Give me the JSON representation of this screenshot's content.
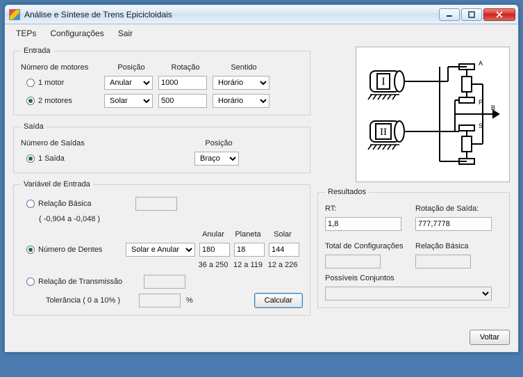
{
  "window": {
    "title": "Análise e Síntese de Trens Epicicloidais"
  },
  "menu": {
    "teps": "TEPs",
    "config": "Configurações",
    "sair": "Sair"
  },
  "entrada": {
    "legend": "Entrada",
    "numMotoresLabel": "Número de motores",
    "opt1": "1 motor",
    "opt2": "2 motores",
    "hdrPosicao": "Posição",
    "hdrRotacao": "Rotação",
    "hdrSentido": "Sentido",
    "row1": {
      "posicao": "Anular",
      "rotacao": "1000",
      "sentido": "Horário"
    },
    "row2": {
      "posicao": "Solar",
      "rotacao": "500",
      "sentido": "Horário"
    }
  },
  "saida": {
    "legend": "Saída",
    "numSaidasLabel": "Número de Saídas",
    "opt1": "1 Saída",
    "hdrPosicao": "Posição",
    "posicao": "Braço"
  },
  "var": {
    "legend": "Variável de Entrada",
    "relBasica": "Relação Básica",
    "relBasicaRange": "( -0,904 a -0,048 )",
    "numDentes": "Número de Dentes",
    "dentesMode": "Solar e Anular",
    "hdrAnular": "Anular",
    "hdrPlaneta": "Planeta",
    "hdrSolar": "Solar",
    "anular": "180",
    "planeta": "18",
    "solar": "144",
    "rangeAnular": "36 a 250",
    "rangePlaneta": "12 a 119",
    "rangeSolar": "12 a 226",
    "relTrans": "Relação de Transmissão",
    "tolLabel": "Tolerância ( 0  a 10% )",
    "pct": "%",
    "calcular": "Calcular"
  },
  "res": {
    "legend": "Resultados",
    "rtLabel": "RT:",
    "rt": "1,8",
    "rotSaidaLabel": "Rotação de Saída:",
    "rotSaida": "777,7778",
    "totalConfig": "Total de Configurações",
    "relBasica": "Relação Básica",
    "possiveis": "Possíveis Conjuntos"
  },
  "diagram": {
    "I": "I",
    "II": "II",
    "A": "A",
    "P": "P",
    "S": "S",
    "B": "B"
  },
  "voltar": "Voltar"
}
